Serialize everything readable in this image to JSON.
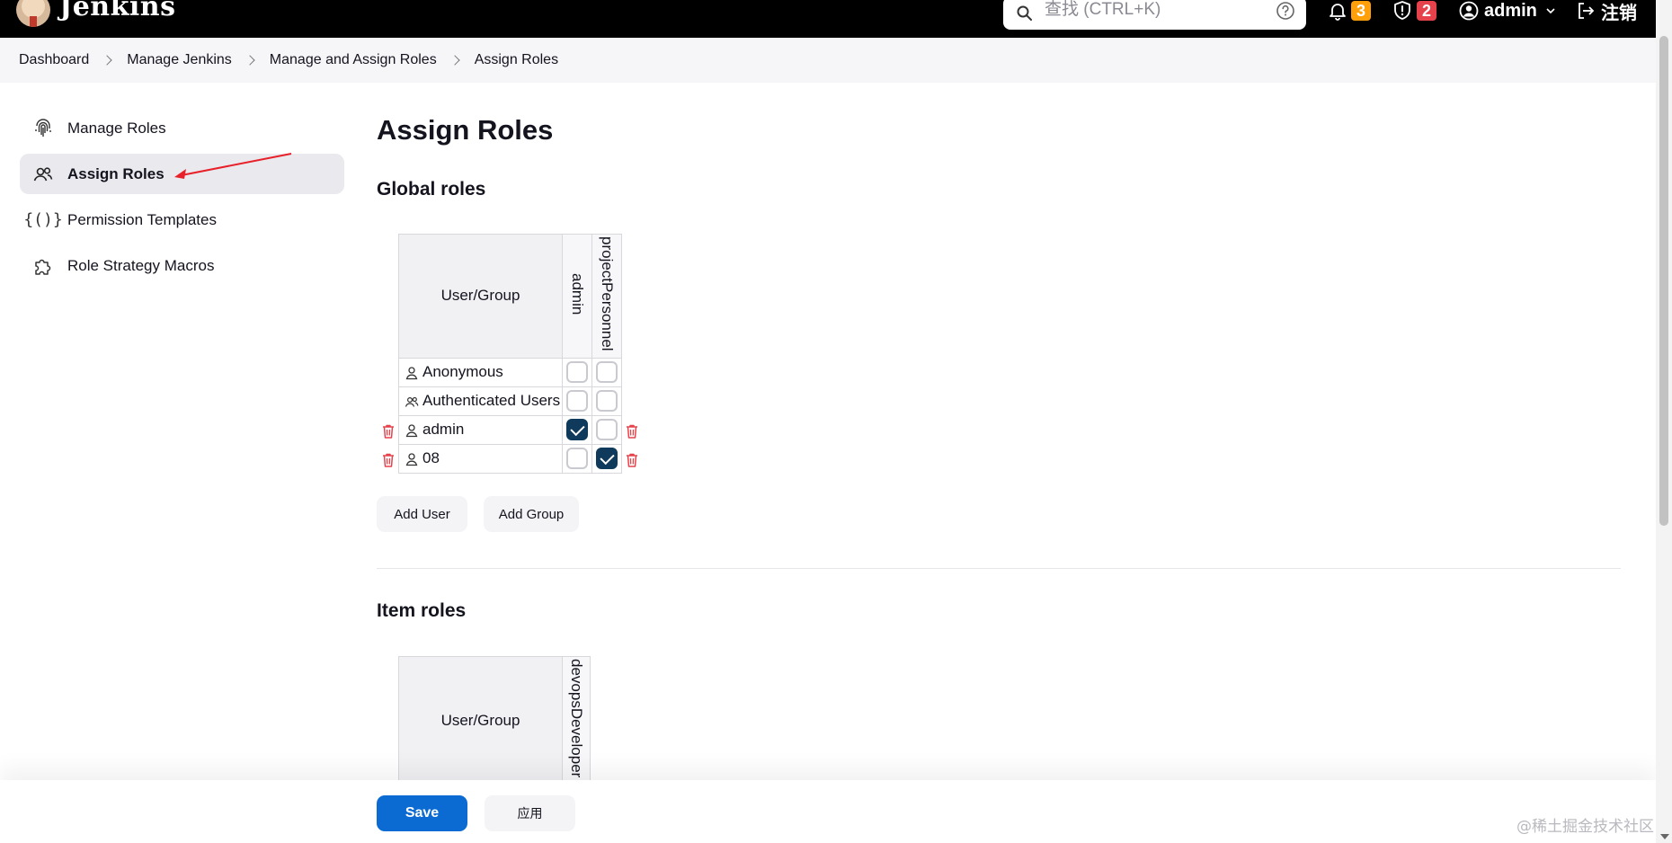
{
  "header": {
    "brand": "Jenkins",
    "search_placeholder": "查找 (CTRL+K)",
    "notifications_count": "3",
    "security_count": "2",
    "user": "admin",
    "logout": "注销"
  },
  "breadcrumb": [
    "Dashboard",
    "Manage Jenkins",
    "Manage and Assign Roles",
    "Assign Roles"
  ],
  "sidebar": {
    "items": [
      {
        "label": "Manage Roles",
        "icon": "fingerprint-icon"
      },
      {
        "label": "Assign Roles",
        "icon": "users-icon"
      },
      {
        "label": "Permission Templates",
        "icon": "braces-icon"
      },
      {
        "label": "Role Strategy Macros",
        "icon": "puzzle-icon"
      }
    ]
  },
  "page": {
    "title": "Assign Roles",
    "global_roles_title": "Global roles",
    "item_roles_title": "Item roles"
  },
  "global_table": {
    "header_user": "User/Group",
    "roles": [
      "admin",
      "projectPersonnel"
    ],
    "rows": [
      {
        "name": "Anonymous",
        "type": "user",
        "checks": [
          false,
          false
        ],
        "deletable": false
      },
      {
        "name": "Authenticated Users",
        "type": "group",
        "checks": [
          false,
          false
        ],
        "deletable": false
      },
      {
        "name": "admin",
        "type": "user",
        "checks": [
          true,
          false
        ],
        "deletable": true
      },
      {
        "name": "08",
        "type": "user",
        "checks": [
          false,
          true
        ],
        "deletable": true
      }
    ],
    "add_user": "Add User",
    "add_group": "Add Group"
  },
  "item_table": {
    "header_user": "User/Group",
    "roles": [
      "devopsDeveloper"
    ]
  },
  "footer": {
    "save": "Save",
    "apply": "应用",
    "watermark": "@稀土掘金技术社区"
  },
  "colors": {
    "header_bg": "#000000",
    "primary": "#0b6bd2",
    "checked": "#0f3a5c",
    "delete": "#e6424c",
    "annotation_arrow": "#e8202a"
  }
}
